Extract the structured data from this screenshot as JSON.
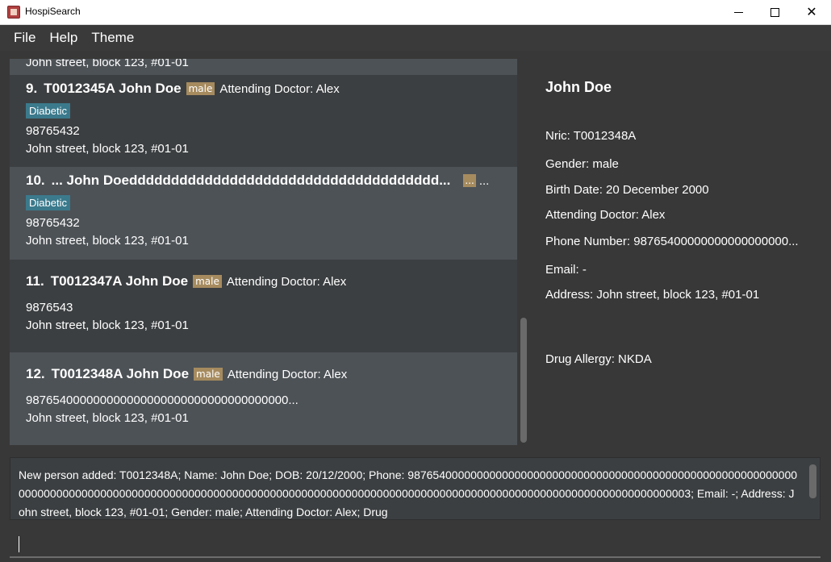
{
  "window": {
    "title": "HospiSearch"
  },
  "menu": [
    "File",
    "Help",
    "Theme"
  ],
  "patients": [
    {
      "address": "John street, block 123, #01-01"
    },
    {
      "index": "9.",
      "name": "T0012345A John Doe",
      "gender": "male",
      "doctor": "Attending Doctor: Alex",
      "tag": "Diabetic",
      "phone": "98765432",
      "address": "John street, block 123, #01-01"
    },
    {
      "index": "10.",
      "name": "... John Doeddddddddddddddddddddddddddddddddddddd...",
      "gender": "...",
      "doctor": "...",
      "tag": "Diabetic",
      "phone": "98765432",
      "address": "John street, block 123, #01-01"
    },
    {
      "index": "11.",
      "name": "T0012347A John Doe",
      "gender": "male",
      "doctor": "Attending Doctor: Alex",
      "phone": "9876543",
      "address": "John street, block 123, #01-01"
    },
    {
      "index": "12.",
      "name": "T0012348A John Doe",
      "gender": "male",
      "doctor": "Attending Doctor: Alex",
      "phone": "987654000000000000000000000000000000000...",
      "address": "John street, block 123, #01-01"
    }
  ],
  "detail": {
    "name": "John Doe",
    "nric": "Nric: T0012348A",
    "gender": "Gender: male",
    "birth_date": "Birth Date: 20 December 2000",
    "doctor": "Attending Doctor: Alex",
    "phone": "Phone Number: 98765400000000000000000...",
    "email": "Email: -",
    "address": "Address: John street, block 123, #01-01",
    "drug_allergy": "Drug Allergy: NKDA"
  },
  "result": {
    "text": "New person added: T0012348A; Name: John Doe; DOB: 20/12/2000; Phone: 9876540000000000000000000000000000000000000000000000000000000000000000000000000000000000000000000000000000000000000000000000000000000000000000000000000000000000000000003; Email: -; Address: John street, block 123, #01-01; Gender: male; Attending Doctor: Alex; Drug"
  },
  "command": {
    "value": "",
    "placeholder": ""
  },
  "colors": {
    "accent_tag": "#3b7a8c",
    "gender_tag": "#a68b5f",
    "background": "#383838"
  }
}
